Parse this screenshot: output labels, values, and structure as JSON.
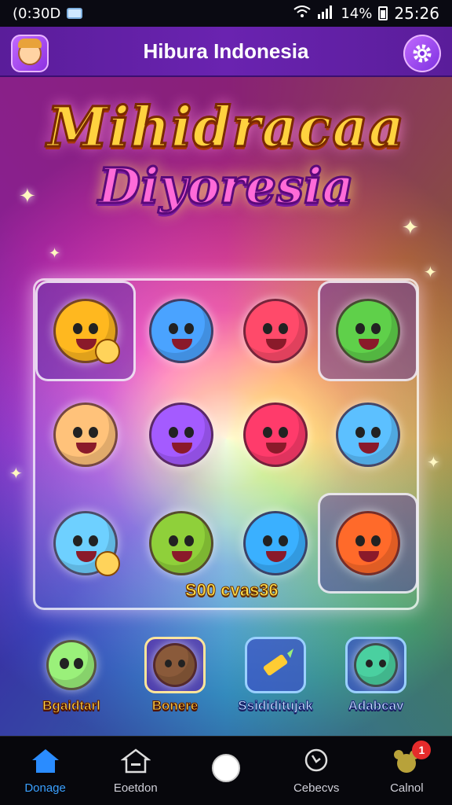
{
  "status_bar": {
    "left_text": "(0:30D",
    "battery_text": "14%",
    "time": "25:26"
  },
  "app_bar": {
    "title": "Hibura Indonesia",
    "avatar_icon": "avatar-icon",
    "settings_icon": "gear-icon"
  },
  "logo": {
    "line1": "Mihidracaa",
    "line2": "Diyoresia"
  },
  "grid": {
    "tiles": [
      {
        "color": "#ffb81f",
        "framed": true
      },
      {
        "color": "#4aa3ff",
        "framed": false
      },
      {
        "color": "#ff4a6a",
        "framed": false
      },
      {
        "color": "#5fd04a",
        "framed": true
      },
      {
        "color": "#ffc27a",
        "framed": false
      },
      {
        "color": "#a45bff",
        "framed": false
      },
      {
        "color": "#ff3b6b",
        "framed": false
      },
      {
        "color": "#5cc0ff",
        "framed": false
      },
      {
        "color": "#6ed0ff",
        "framed": false
      },
      {
        "color": "#8fd03a",
        "framed": false
      },
      {
        "color": "#3ab0ff",
        "framed": false
      },
      {
        "color": "#ff6a2a",
        "framed": true
      }
    ],
    "coins_text": "S00 cvas36"
  },
  "features": [
    {
      "label": "Bgaidtarl",
      "color": "#9af07a"
    },
    {
      "label": "Bonere",
      "color": "#8a5a3a"
    },
    {
      "label": "Ssididitujak",
      "color": "#ffcc33"
    },
    {
      "label": "Adabcav",
      "color": "#4ad0a0"
    }
  ],
  "nav": {
    "items": [
      {
        "label": "Donage",
        "icon": "home-icon"
      },
      {
        "label": "Eoetdon",
        "icon": "house-outline-icon"
      },
      {
        "label": "",
        "icon": "circle-home-button"
      },
      {
        "label": "Cebecvs",
        "icon": "search-icon"
      },
      {
        "label": "Calnol",
        "icon": "bear-icon"
      }
    ],
    "notification_count": "1"
  }
}
